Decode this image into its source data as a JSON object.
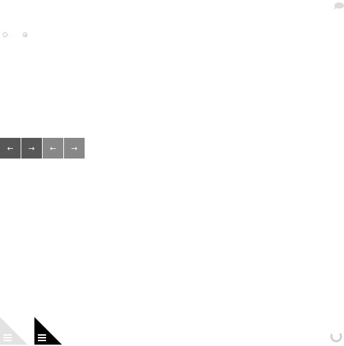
{
  "icons": {
    "comment": "speech-bubble-icon",
    "prev": "arrow-left-icon",
    "next": "arrow-right-icon",
    "menu": "hamburger-menu-icon",
    "refresh": "refresh-icon"
  },
  "nav": {
    "group1_prev": "←",
    "group1_next": "→",
    "group2_prev": "←",
    "group2_next": "→"
  },
  "colors": {
    "dark_button": "#575757",
    "light_button": "#888888",
    "light_triangle": "#e3e3e3",
    "dark_triangle": "#000000",
    "icon_gray": "#dcdcdc"
  }
}
